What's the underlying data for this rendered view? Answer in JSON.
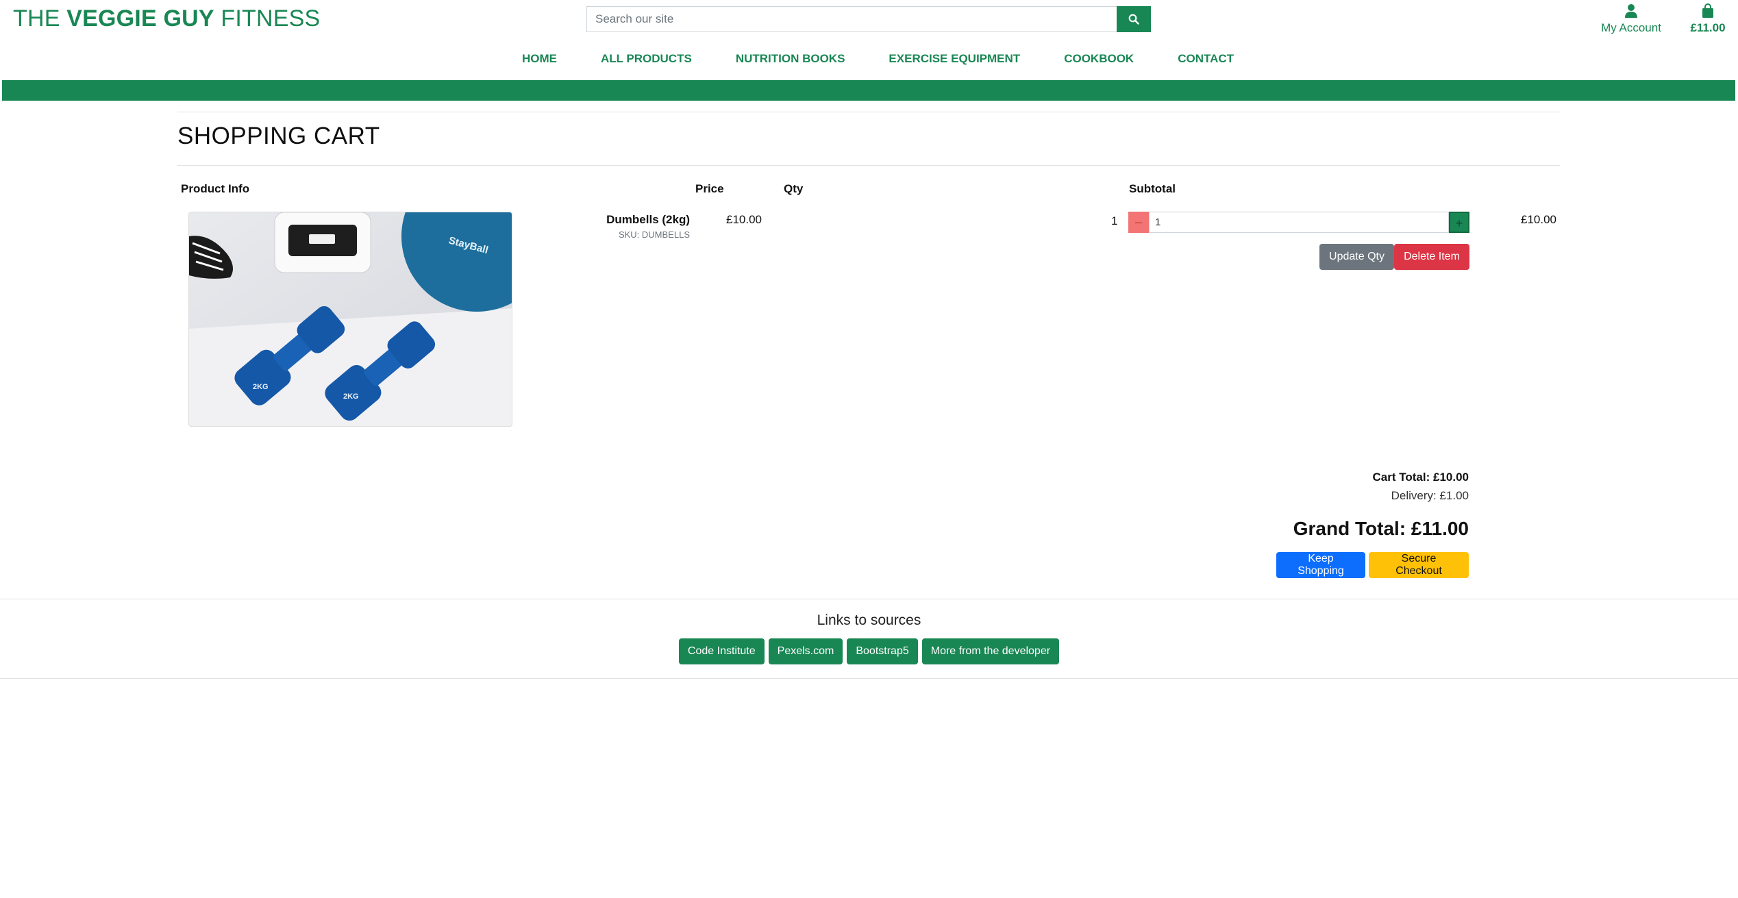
{
  "brand": {
    "prefix": "THE ",
    "bold": "VEGGIE GUY",
    "suffix": " FITNESS"
  },
  "search": {
    "placeholder": "Search our site",
    "icon": "search-icon"
  },
  "account": {
    "label": "My Account",
    "icon": "user-icon"
  },
  "cart_header": {
    "total": "£11.00",
    "icon": "shopping-bag-icon"
  },
  "nav": [
    "HOME",
    "ALL PRODUCTS",
    "NUTRITION BOOKS",
    "EXERCISE EQUIPMENT",
    "COOKBOOK",
    "CONTACT"
  ],
  "colors": {
    "brand": "#198754",
    "danger": "#dc3545",
    "secondary": "#6c757d",
    "primary": "#0d6efd",
    "warning": "#ffc107"
  },
  "cart": {
    "title": "SHOPPING CART",
    "headers": {
      "product": "Product Info",
      "price": "Price",
      "qty": "Qty",
      "subtotal": "Subtotal"
    },
    "item": {
      "name": "Dumbells (2kg)",
      "sku": "SKU: DUMBELLS",
      "price": "£10.00",
      "qty_display": "1",
      "qty_value": "1",
      "minus_label": "–",
      "plus_label": "+",
      "subtotal": "£10.00",
      "update_label": "Update Qty",
      "delete_label": "Delete Item"
    },
    "cart_total": "Cart Total: £10.00",
    "delivery": "Delivery: £1.00",
    "grand_total": "Grand Total: £11.00",
    "keep_shopping": "Keep Shopping",
    "checkout": "Secure Checkout"
  },
  "footer": {
    "title": "Links to sources",
    "links": [
      "Code Institute",
      "Pexels.com",
      "Bootstrap5",
      "More from the developer"
    ]
  }
}
